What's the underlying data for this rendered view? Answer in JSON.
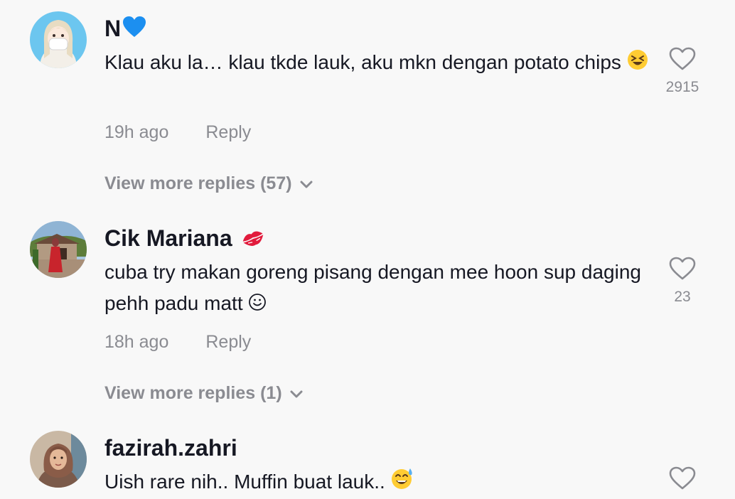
{
  "comments": [
    {
      "username": "N",
      "username_emoji": "blue-heart",
      "text": "Klau aku la… klau tkde lauk, aku mkn dengan potato chips",
      "text_emoji": "grinning-squinting-face",
      "time": "19h ago",
      "reply_label": "Reply",
      "likes": "2915",
      "view_more": "View more replies (57)"
    },
    {
      "username": "Cik Mariana",
      "username_emoji": "kiss-mark",
      "text": "cuba try makan goreng pisang dengan mee hoon sup daging pehh padu matt",
      "text_emoji": "smiling-face",
      "time": "18h ago",
      "reply_label": "Reply",
      "likes": "23",
      "view_more": "View more replies (1)"
    },
    {
      "username": "fazirah.zahri",
      "text": "Uish rare nih.. Muffin buat lauk..",
      "text_emoji": "grinning-face-with-sweat"
    }
  ],
  "colors": {
    "background": "#f8f8f8",
    "text": "#161823",
    "secondary": "#8a8b91"
  }
}
